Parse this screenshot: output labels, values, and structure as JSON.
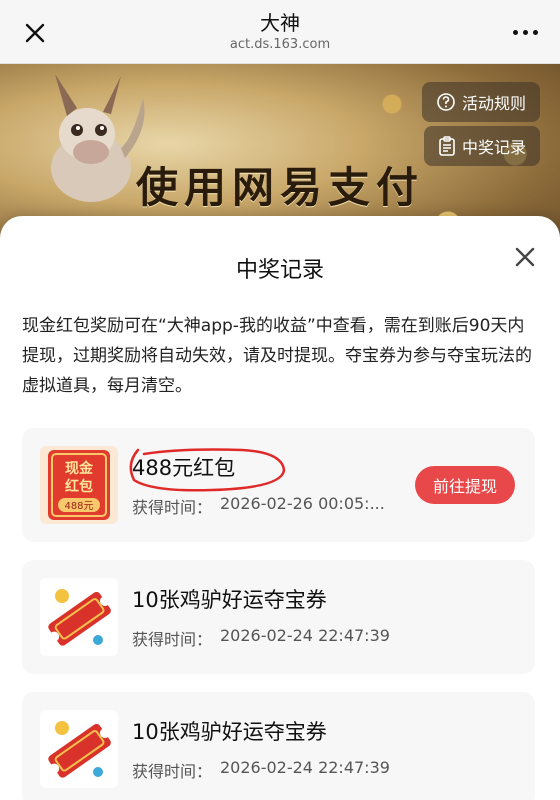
{
  "topbar": {
    "title": "大神",
    "url": "act.ds.163.com"
  },
  "banner": {
    "headline": "使用网易支付",
    "rules_label": "活动规则",
    "records_label": "中奖记录"
  },
  "sheet": {
    "title": "中奖记录",
    "notice": "现金红包奖励可在“大神app-我的收益”中查看，需在到账后90天内提现，过期奖励将自动失效，请及时提现。夺宝券为参与夺宝玩法的虚拟道具，每月清空。",
    "time_label": "获得时间：",
    "records": [
      {
        "name": "488元红包",
        "time": "2026-02-26 00:05:...",
        "action": "前往提现",
        "thumb_text_top": "现金",
        "thumb_text_mid": "红包",
        "thumb_amount": "488元"
      },
      {
        "name": "10张鸡驴好运夺宝券",
        "time": "2026-02-24 22:47:39"
      },
      {
        "name": "10张鸡驴好运夺宝券",
        "time": "2026-02-24 22:47:39"
      }
    ]
  },
  "colors": {
    "accent": "#e8484a",
    "card_bg": "#f7f7f7"
  }
}
